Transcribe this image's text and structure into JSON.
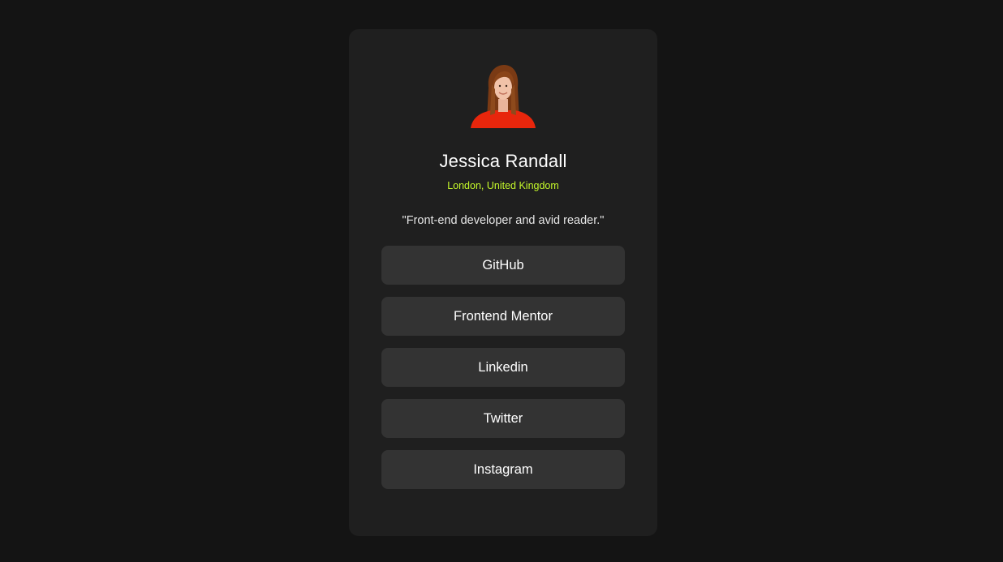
{
  "profile": {
    "avatar_icon": "person-photo",
    "name": "Jessica Randall",
    "location": "London, United Kingdom",
    "bio": "\"Front-end developer and avid reader.\""
  },
  "links": [
    {
      "label": "GitHub"
    },
    {
      "label": "Frontend Mentor"
    },
    {
      "label": "Linkedin"
    },
    {
      "label": "Twitter"
    },
    {
      "label": "Instagram"
    }
  ],
  "colors": {
    "page_bg": "#141414",
    "card_bg": "#1f1f1f",
    "button_bg": "#333333",
    "accent": "#c4f82a"
  }
}
